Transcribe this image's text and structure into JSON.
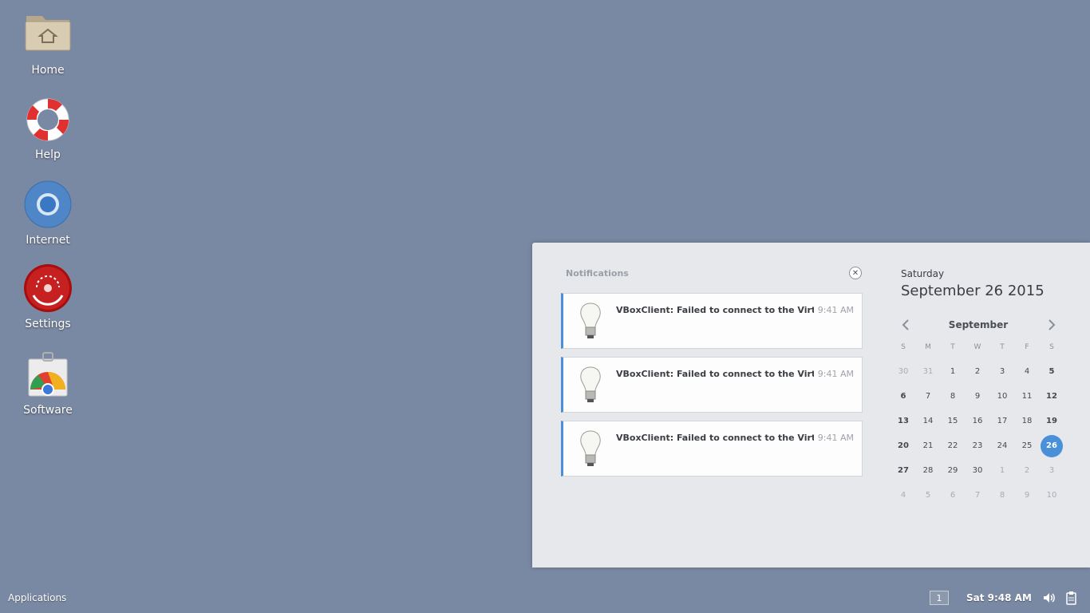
{
  "desktop": {
    "icons": [
      {
        "label": "Home",
        "icon": "home-folder-icon"
      },
      {
        "label": "Help",
        "icon": "lifebuoy-icon"
      },
      {
        "label": "Internet",
        "icon": "chromium-icon"
      },
      {
        "label": "Settings",
        "icon": "settings-icon"
      },
      {
        "label": "Software",
        "icon": "software-store-icon"
      }
    ]
  },
  "panel": {
    "applications_label": "Applications",
    "workspace": "1",
    "clock": "Sat  9:48 AM",
    "volume_icon": "volume-icon",
    "clipboard_icon": "clipboard-icon"
  },
  "tray": {
    "notifications_title": "Notifications",
    "clear_icon": "close-icon",
    "notifications": [
      {
        "message": "VBoxClient: Failed to connect to the Virtu...",
        "time": "9:41 AM",
        "icon": "lightbulb-icon"
      },
      {
        "message": "VBoxClient: Failed to connect to the Virtu...",
        "time": "9:41 AM",
        "icon": "lightbulb-icon"
      },
      {
        "message": "VBoxClient: Failed to connect to the Virtu...",
        "time": "9:41 AM",
        "icon": "lightbulb-icon"
      }
    ]
  },
  "calendar": {
    "day_name": "Saturday",
    "full_date": "September 26 2015",
    "month": "September",
    "weekday_headers": [
      "S",
      "M",
      "T",
      "W",
      "T",
      "F",
      "S"
    ],
    "weeks": [
      [
        "30",
        "31",
        "1",
        "2",
        "3",
        "4",
        "5"
      ],
      [
        "6",
        "7",
        "8",
        "9",
        "10",
        "11",
        "12"
      ],
      [
        "13",
        "14",
        "15",
        "16",
        "17",
        "18",
        "19"
      ],
      [
        "20",
        "21",
        "22",
        "23",
        "24",
        "25",
        "26"
      ],
      [
        "27",
        "28",
        "29",
        "30",
        "1",
        "2",
        "3"
      ],
      [
        "4",
        "5",
        "6",
        "7",
        "8",
        "9",
        "10"
      ]
    ],
    "today": "26",
    "colors": {
      "accent": "#4a90d9",
      "background": "#7a89a3"
    }
  }
}
